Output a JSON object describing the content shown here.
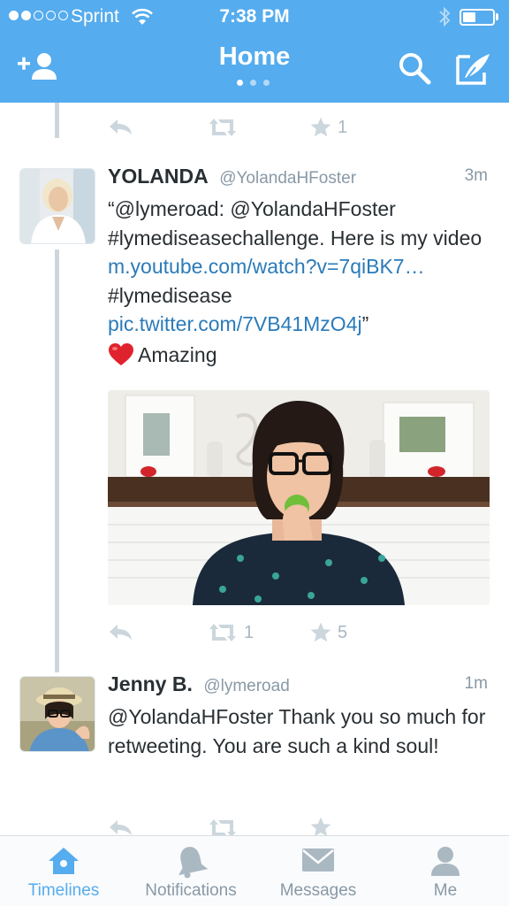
{
  "status_bar": {
    "carrier": "Sprint",
    "time": "7:38 PM",
    "signal_bars_filled": 2,
    "signal_bars_total": 5,
    "battery_level_fraction": 0.35
  },
  "header": {
    "title": "Home",
    "page_indicator": {
      "count": 3,
      "active_index": 0
    },
    "background_color": "#55acee",
    "icons": [
      "add-user-icon",
      "search-icon",
      "compose-icon"
    ]
  },
  "timeline": {
    "prev_tweet_actions": {
      "retweets": "",
      "favorites": "1"
    },
    "tweets": [
      {
        "name": "YOLANDA",
        "handle": "@YolandaHFoster",
        "time": "3m",
        "text_parts": [
          "“@lymeroad: @YolandaHFoster #lymediseasechallenge. Here is my video ",
          "m.youtube.com/watch?v=7qiBK7…",
          " #lymedisease ",
          "pic.twitter.com/7VB41MzO4j",
          "”"
        ],
        "comment": "Amazing",
        "comment_emoji": "red-heart",
        "media": "photo-woman-eating-apple",
        "retweets": "1",
        "favorites": "5"
      },
      {
        "name": "Jenny B.",
        "handle": "@lymeroad",
        "time": "1m",
        "text": "@YolandaHFoster Thank you so much for retweeting. You are such a kind soul!",
        "retweets": "",
        "favorites": ""
      }
    ]
  },
  "tabbar": {
    "tabs": [
      {
        "label": "Timelines",
        "icon": "home-icon",
        "active": true
      },
      {
        "label": "Notifications",
        "icon": "bell-icon",
        "active": false
      },
      {
        "label": "Messages",
        "icon": "envelope-icon",
        "active": false
      },
      {
        "label": "Me",
        "icon": "person-icon",
        "active": false
      }
    ],
    "active_color": "#55acee",
    "inactive_color": "#8899a6"
  }
}
